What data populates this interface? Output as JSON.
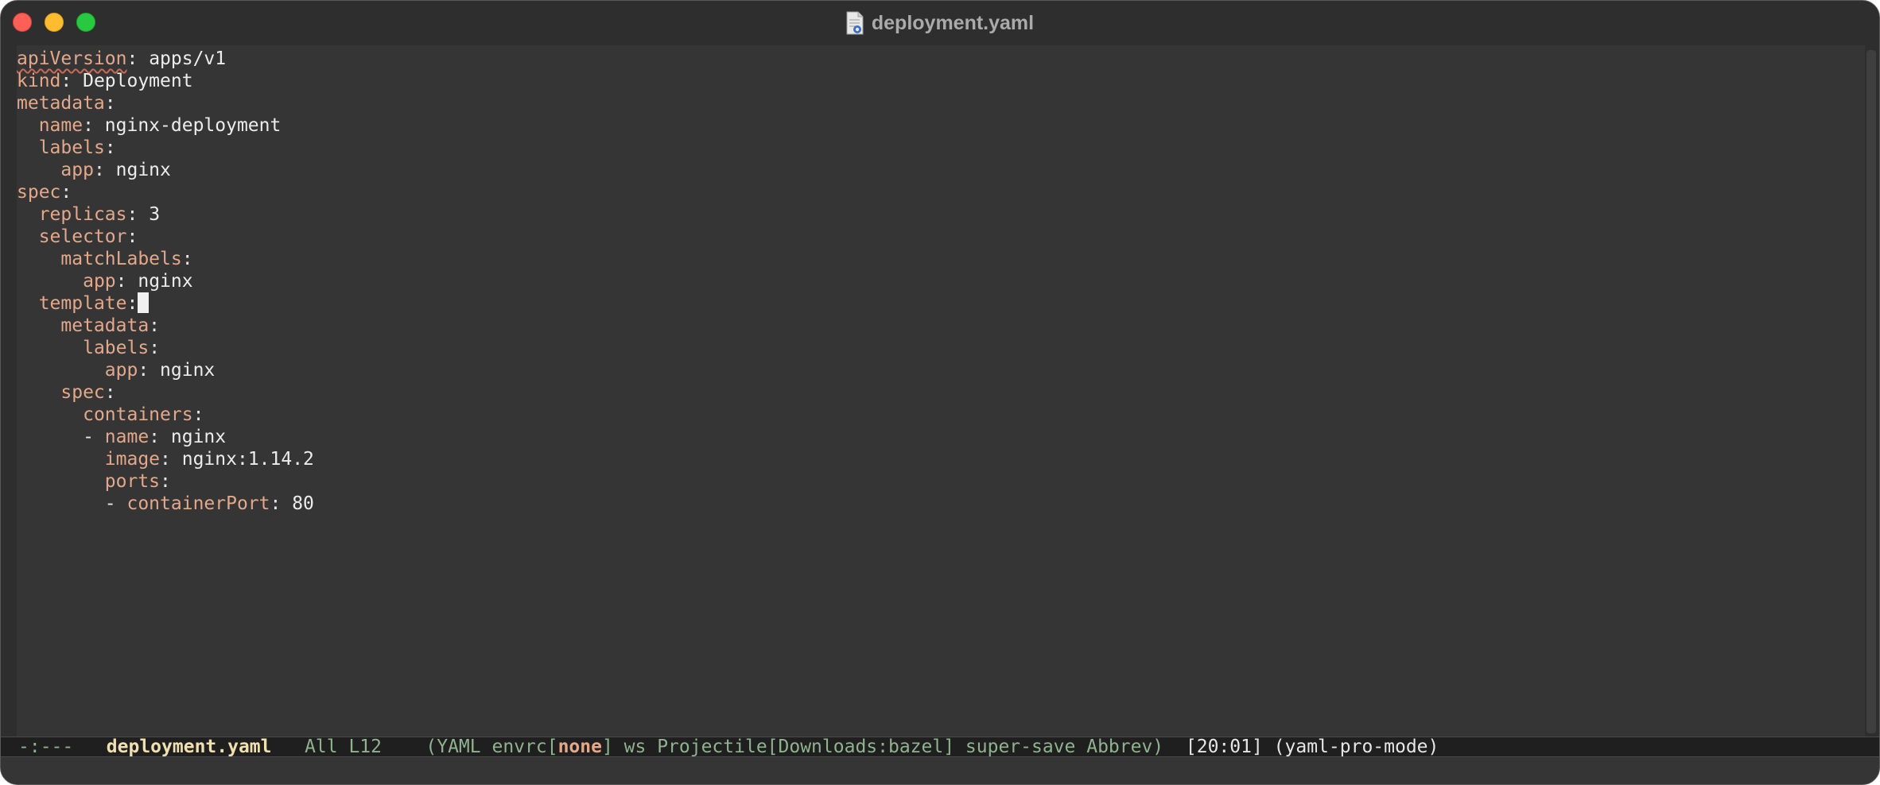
{
  "window": {
    "title": "deployment.yaml",
    "file_icon": "yaml-document-icon"
  },
  "editor": {
    "lines": [
      {
        "indent": "",
        "key": "apiVersion",
        "sep": ": ",
        "value": "apps/v1",
        "squiggle": true
      },
      {
        "indent": "",
        "key": "kind",
        "sep": ": ",
        "value": "Deployment"
      },
      {
        "indent": "",
        "key": "metadata",
        "sep": ":",
        "value": ""
      },
      {
        "indent": "  ",
        "key": "name",
        "sep": ": ",
        "value": "nginx-deployment"
      },
      {
        "indent": "  ",
        "key": "labels",
        "sep": ":",
        "value": ""
      },
      {
        "indent": "    ",
        "key": "app",
        "sep": ": ",
        "value": "nginx"
      },
      {
        "indent": "",
        "key": "spec",
        "sep": ":",
        "value": ""
      },
      {
        "indent": "  ",
        "key": "replicas",
        "sep": ": ",
        "value": "3"
      },
      {
        "indent": "  ",
        "key": "selector",
        "sep": ":",
        "value": ""
      },
      {
        "indent": "    ",
        "key": "matchLabels",
        "sep": ":",
        "value": ""
      },
      {
        "indent": "      ",
        "key": "app",
        "sep": ": ",
        "value": "nginx"
      },
      {
        "indent": "  ",
        "key": "template",
        "sep": ":",
        "value": "",
        "cursor": true
      },
      {
        "indent": "    ",
        "key": "metadata",
        "sep": ":",
        "value": ""
      },
      {
        "indent": "      ",
        "key": "labels",
        "sep": ":",
        "value": ""
      },
      {
        "indent": "        ",
        "key": "app",
        "sep": ": ",
        "value": "nginx"
      },
      {
        "indent": "    ",
        "key": "spec",
        "sep": ":",
        "value": ""
      },
      {
        "indent": "      ",
        "key": "containers",
        "sep": ":",
        "value": ""
      },
      {
        "indent": "      - ",
        "key": "name",
        "sep": ": ",
        "value": "nginx"
      },
      {
        "indent": "        ",
        "key": "image",
        "sep": ": ",
        "value": "nginx:1.14.2"
      },
      {
        "indent": "        ",
        "key": "ports",
        "sep": ":",
        "value": ""
      },
      {
        "indent": "        - ",
        "key": "containerPort",
        "sep": ": ",
        "value": "80"
      }
    ]
  },
  "modeline": {
    "status": "-:---",
    "buffer_name": "deployment.yaml",
    "position": "All L12",
    "modes_prefix": "(YAML envrc[",
    "envrc_value": "none",
    "modes_suffix": "] ws Projectile[Downloads:bazel] super-save Abbrev)",
    "time": "[20:01]",
    "major_mode": "(yaml-pro-mode)"
  },
  "colors": {
    "background": "#353535",
    "key": "#e3a88b",
    "value": "#ececec",
    "modeline_green": "#8fb28f",
    "modeline_buffer": "#f0dfaf"
  }
}
